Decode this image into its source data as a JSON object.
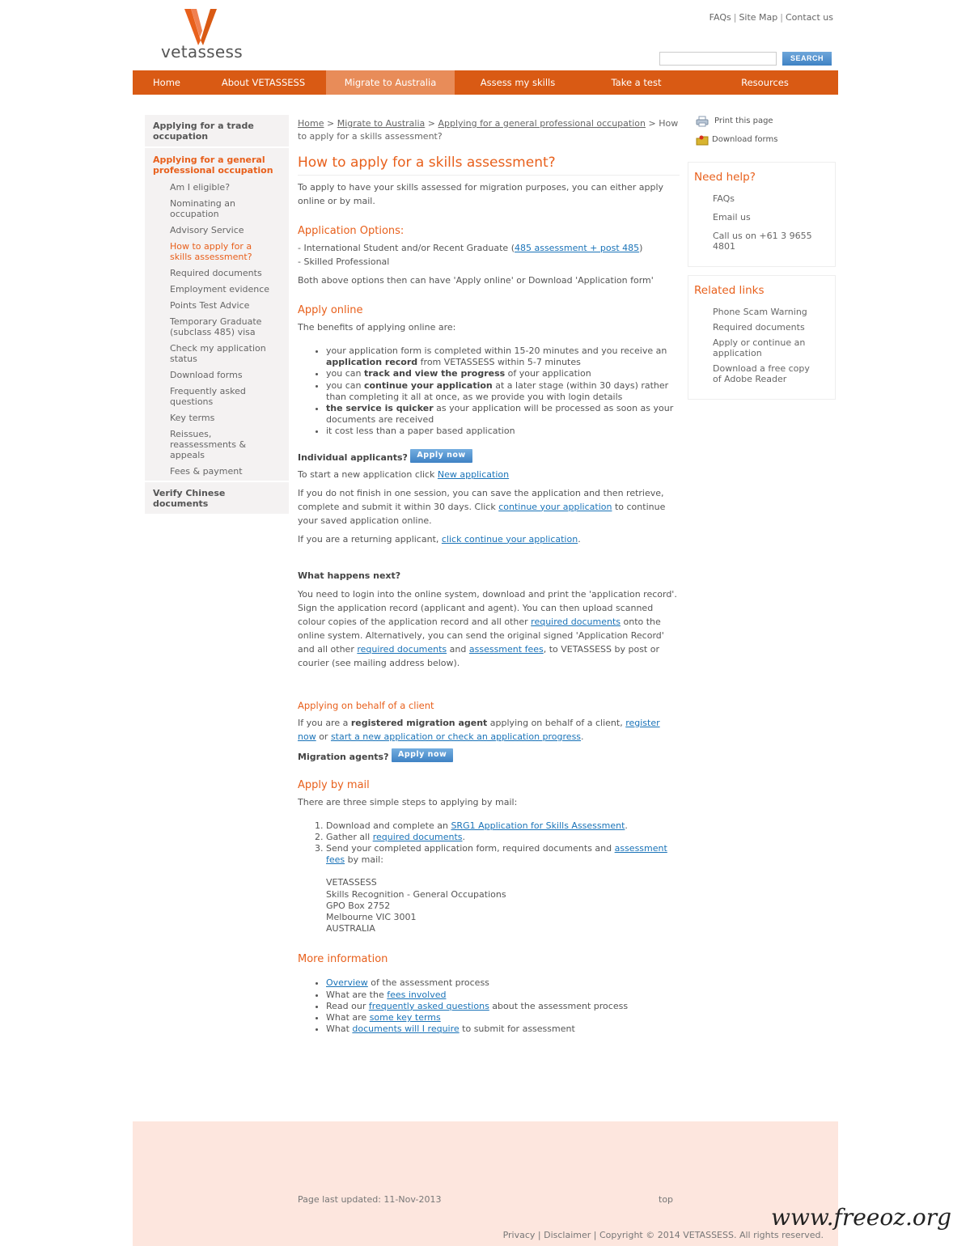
{
  "header": {
    "logo_text": "vetassess",
    "top_links": [
      "FAQs",
      "Site Map",
      "Contact us"
    ],
    "search_placeholder": "",
    "search_button": "SEARCH"
  },
  "nav": {
    "items": [
      {
        "label": "Home"
      },
      {
        "label": "About VETASSESS"
      },
      {
        "label": "Migrate to Australia",
        "active": true
      },
      {
        "label": "Assess my skills"
      },
      {
        "label": "Take a test"
      },
      {
        "label": "Resources"
      }
    ]
  },
  "colors": {
    "brand": "#d95a14",
    "accent_text": "#e8601c",
    "link": "#1a73b8",
    "footer_bg": "#fde6de"
  },
  "sidebar": {
    "top": "Applying for a trade occupation",
    "section": "Applying for a general professional occupation",
    "items": [
      "Am I eligible?",
      "Nominating an occupation",
      "Advisory Service",
      "How to apply for a skills assessment?",
      "Required documents",
      "Employment evidence",
      "Points Test Advice",
      "Temporary Graduate (subclass 485) visa",
      "Check my application status",
      "Download forms",
      "Frequently asked questions",
      "Key terms",
      "Reissues, reassessments & appeals",
      "Fees & payment"
    ],
    "current_index": 3,
    "bottom": "Verify Chinese documents"
  },
  "breadcrumb": {
    "items": [
      "Home",
      "Migrate to Australia",
      "Applying for a general professional occupation"
    ],
    "current": "How to apply for a skills assessment?",
    "separator": ">"
  },
  "main": {
    "title": "How to apply for a skills assessment?",
    "intro": "To apply to have your skills assessed for migration purposes, you can either apply online or by mail.",
    "options_heading": "Application Options:",
    "option1": [
      {
        "t": "- International Student and/or Recent Graduate ("
      },
      {
        "t": "485 assessment + post 485",
        "link": true
      },
      {
        "t": ")"
      }
    ],
    "option2": "- Skilled Professional",
    "options_note": "Both above options then can have 'Apply online' or Download 'Application form'",
    "apply_online_heading": "Apply online",
    "benefits_intro": "The benefits of applying online are:",
    "benefits": [
      [
        {
          "t": "your application form is completed within 15-20 minutes and you receive an "
        },
        {
          "t": "application record",
          "bold": true
        },
        {
          "t": " from VETASSESS within 5-7 minutes"
        }
      ],
      [
        {
          "t": "you can "
        },
        {
          "t": "track and view the progress",
          "bold": true
        },
        {
          "t": " of your application"
        }
      ],
      [
        {
          "t": "you can "
        },
        {
          "t": "continue your application",
          "bold": true
        },
        {
          "t": " at a later stage (within 30 days) rather than completing it all at once, as we provide you with login details"
        }
      ],
      [
        {
          "t": "the service is quicker",
          "bold": true
        },
        {
          "t": " as your application will be processed as soon as your documents are received"
        }
      ],
      [
        {
          "t": "it cost less than a paper based application"
        }
      ]
    ],
    "individual_label": "Individual applicants?",
    "apply_now": "Apply now",
    "new_app": [
      {
        "t": "To start a new application click "
      },
      {
        "t": "New application",
        "link": true
      }
    ],
    "save_para": [
      {
        "t": "If you do not finish in one session, you can save the application and then retrieve, complete and submit it within 30 days. Click "
      },
      {
        "t": "continue your application",
        "link": true
      },
      {
        "t": " to continue your saved application online."
      }
    ],
    "returning": [
      {
        "t": "If you are a returning applicant, "
      },
      {
        "t": "click continue your application",
        "link": true
      },
      {
        "t": "."
      }
    ],
    "next_heading": "What happens next?",
    "next_para": [
      {
        "t": "You need to login into the online system, download and print the 'application record'. Sign the application record (applicant and agent). You can then upload scanned colour copies of the application record and all other "
      },
      {
        "t": "required documents",
        "link": true
      },
      {
        "t": " onto the online system. Alternatively, you can send the original signed 'Application Record' and all other "
      },
      {
        "t": "required documents",
        "link": true
      },
      {
        "t": " and "
      },
      {
        "t": "assessment fees",
        "link": true
      },
      {
        "t": ", to VETASSESS by post or courier (see mailing address below)."
      }
    ],
    "behalf_heading": "Applying on behalf of a client",
    "behalf_para": [
      {
        "t": "If you are a "
      },
      {
        "t": "registered migration agent",
        "bold": true
      },
      {
        "t": " applying on behalf of a client, "
      },
      {
        "t": "register now",
        "link": true
      },
      {
        "t": " or "
      },
      {
        "t": "start a new application or check an application progress",
        "link": true
      },
      {
        "t": "."
      }
    ],
    "agents_label": "Migration agents?",
    "mail_heading": "Apply by mail",
    "mail_intro": "There are three simple steps to applying by mail:",
    "mail_steps": [
      [
        {
          "t": "Download and complete an "
        },
        {
          "t": "SRG1 Application for Skills Assessment",
          "link": true
        },
        {
          "t": "."
        }
      ],
      [
        {
          "t": "Gather all "
        },
        {
          "t": "required documents",
          "link": true
        },
        {
          "t": "."
        }
      ],
      [
        {
          "t": "Send your completed application form, required documents and "
        },
        {
          "t": "assessment fees",
          "link": true
        },
        {
          "t": " by mail:"
        }
      ]
    ],
    "address": [
      "VETASSESS",
      "Skills Recognition - General Occupations",
      "GPO Box 2752",
      "Melbourne VIC 3001",
      "AUSTRALIA"
    ],
    "more_heading": "More information",
    "more_items": [
      [
        {
          "t": "Overview",
          "link": true
        },
        {
          "t": " of the assessment process"
        }
      ],
      [
        {
          "t": "What are the "
        },
        {
          "t": "fees involved",
          "link": true
        }
      ],
      [
        {
          "t": "Read our "
        },
        {
          "t": "frequently asked questions",
          "link": true
        },
        {
          "t": " about the assessment process"
        }
      ],
      [
        {
          "t": "What are "
        },
        {
          "t": "some key terms",
          "link": true
        }
      ],
      [
        {
          "t": "What "
        },
        {
          "t": "documents will I require",
          "link": true
        },
        {
          "t": " to submit for assessment"
        }
      ]
    ]
  },
  "right": {
    "print": "Print this page",
    "download": "Download forms",
    "help_title": "Need help?",
    "help_items": [
      "FAQs",
      "Email us",
      "Call us on +61 3 9655 4801"
    ],
    "related_title": "Related links",
    "related_items": [
      "Phone Scam Warning",
      "Required documents",
      "Apply or continue an application",
      "Download a free copy of Adobe Reader"
    ]
  },
  "footer": {
    "updated": "Page last updated: 11-Nov-2013",
    "top": "top",
    "links": [
      "Privacy",
      "Disclaimer"
    ],
    "copyright": "Copyright © 2014 VETASSESS. All rights reserved."
  },
  "watermark": "www.freeoz.org"
}
